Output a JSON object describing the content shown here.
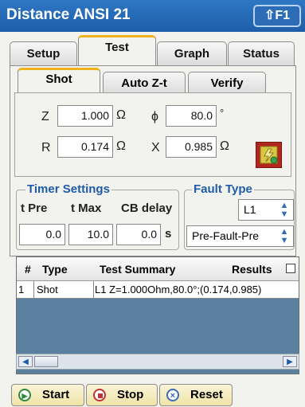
{
  "title": "Distance ANSI 21",
  "help_label": "⇧F1",
  "main_tabs": [
    {
      "label": "Setup"
    },
    {
      "label": "Test"
    },
    {
      "label": "Graph"
    },
    {
      "label": "Status"
    }
  ],
  "sub_tabs": [
    {
      "label": "Shot"
    },
    {
      "label": "Auto Z-t"
    },
    {
      "label": "Verify"
    }
  ],
  "shot": {
    "z_label": "Z",
    "z_value": "1.000",
    "z_unit": "Ω",
    "phi_label": "ϕ",
    "phi_value": "80.0",
    "phi_unit": "°",
    "r_label": "R",
    "r_value": "0.174",
    "r_unit": "Ω",
    "x_label": "X",
    "x_value": "0.985",
    "x_unit": "Ω"
  },
  "timer": {
    "title": "Timer Settings",
    "tpre_label": "t Pre",
    "tmax_label": "t Max",
    "cbdelay_label": "CB delay",
    "tpre_value": "0.0",
    "tmax_value": "10.0",
    "cbdelay_value": "0.0",
    "unit": "s"
  },
  "fault": {
    "title": "Fault Type",
    "loop": "L1",
    "mode": "Pre-Fault-Pre"
  },
  "table": {
    "headers": {
      "num": "#",
      "type": "Type",
      "summary": "Test Summary",
      "results": "Results"
    },
    "rows": [
      {
        "num": "1",
        "type": "Shot",
        "summary": "L1 Z=1.000Ohm,80.0°;(0.174,0.985)",
        "results": ""
      }
    ]
  },
  "buttons": {
    "start": "Start",
    "stop": "Stop",
    "reset": "Reset"
  },
  "colors": {
    "accent": "#1f5ba8",
    "tab_highlight": "#f0b21c",
    "grid_empty": "#5b7f9e"
  }
}
